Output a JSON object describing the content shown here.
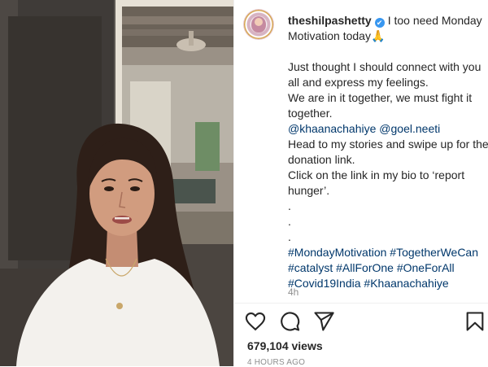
{
  "post": {
    "username": "theshilpashetty",
    "verified_glyph": "✔",
    "caption_lines": [
      {
        "type": "first",
        "text": "I too need Monday Motivation today🙏"
      },
      {
        "type": "gap"
      },
      {
        "type": "text",
        "text": "Just thought I should connect with you all and express my feelings."
      },
      {
        "type": "text",
        "text": "We are in it together, we must fight it together."
      },
      {
        "type": "mentions",
        "items": [
          "@khaanachahiye",
          "@goel.neeti"
        ]
      },
      {
        "type": "text",
        "text": "Head to my stories and swipe up for the donation link."
      },
      {
        "type": "text",
        "text": "Click on the link in my bio to ‘report hunger’."
      },
      {
        "type": "text",
        "text": "."
      },
      {
        "type": "text",
        "text": "."
      },
      {
        "type": "text",
        "text": "."
      },
      {
        "type": "hashtags",
        "items": [
          "#MondayMotivation",
          "#TogetherWeCan",
          "#catalyst",
          "#AllForOne",
          "#OneForAll",
          "#Covid19India",
          "#Khaanachahiye"
        ]
      }
    ],
    "relative_time": "4h",
    "views": "679,104 views",
    "timestamp": "4 HOURS AGO"
  },
  "icons": {
    "like": "heart-icon",
    "comment": "comment-icon",
    "share": "share-icon",
    "save": "bookmark-icon",
    "verified": "verified-badge-icon"
  },
  "colors": {
    "link": "#00376b",
    "verified": "#3897f0",
    "text": "#262626",
    "muted": "#8e8e8e"
  }
}
